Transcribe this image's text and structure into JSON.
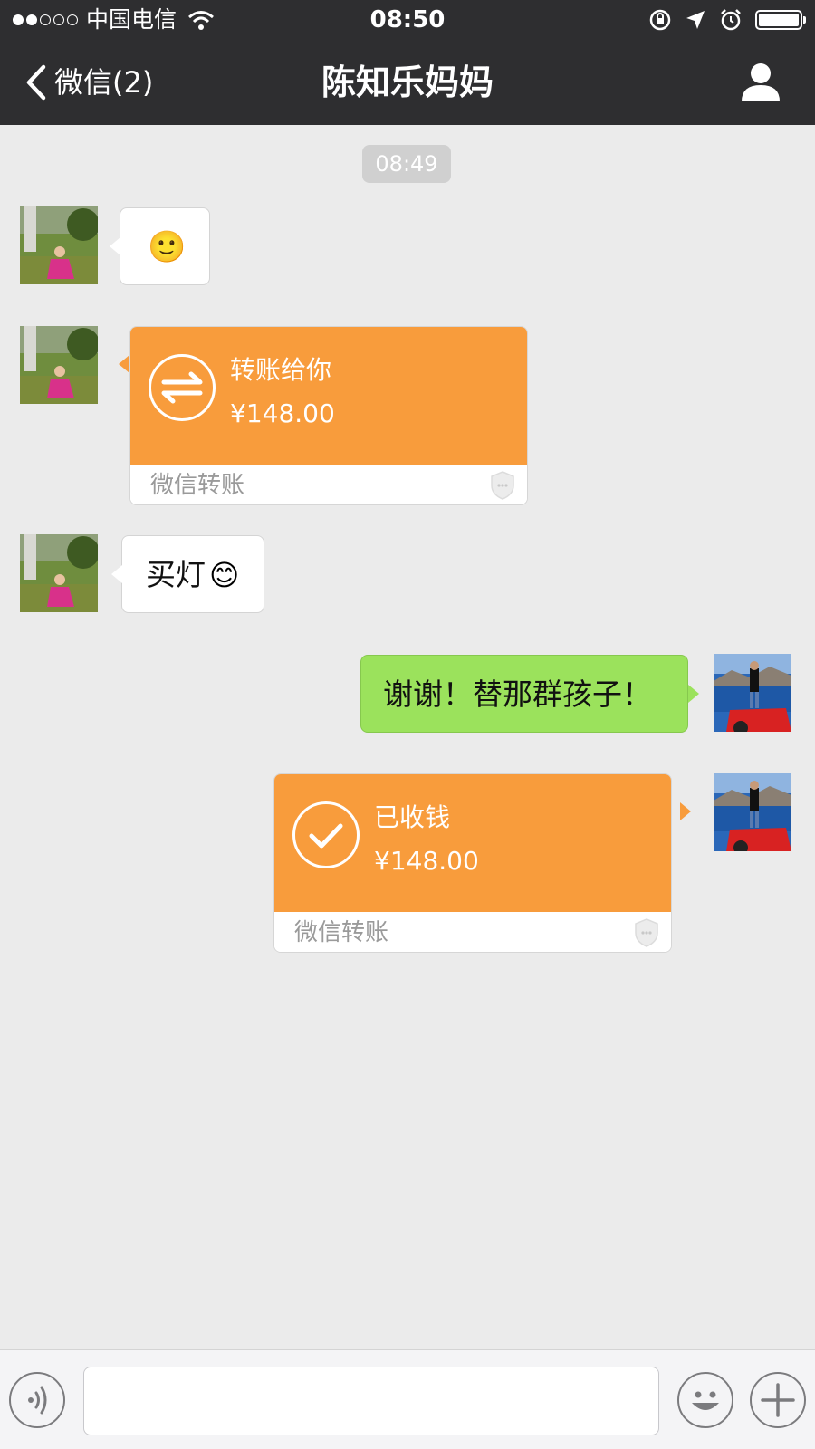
{
  "status_bar": {
    "carrier": "中国电信",
    "time": "08:50",
    "battery_level": 1.0,
    "signal_bars_filled": 2,
    "signal_bars_total": 5
  },
  "nav": {
    "back_label": "微信(2)",
    "title": "陈知乐妈妈",
    "profile_icon": "person-icon"
  },
  "chat": {
    "timestamp": "08:49",
    "messages": [
      {
        "side": "left",
        "type": "emoji",
        "emoji": "🙂"
      },
      {
        "side": "left",
        "type": "transfer",
        "title": "转账给你",
        "amount": "¥148.00",
        "footer": "微信转账",
        "icon": "transfer-arrows-icon"
      },
      {
        "side": "left",
        "type": "text",
        "text": "买灯",
        "emoji": "😊"
      },
      {
        "side": "right",
        "type": "text",
        "text": "谢谢！替那群孩子！"
      },
      {
        "side": "right",
        "type": "transfer",
        "title": "已收钱",
        "amount": "¥148.00",
        "footer": "微信转账",
        "icon": "check-icon"
      }
    ]
  },
  "colors": {
    "header_bg": "#2e2e30",
    "chat_bg": "#ebebeb",
    "transfer_orange": "#f89c3c",
    "bubble_green": "#9be25c"
  },
  "input_bar": {
    "text_value": "",
    "voice_icon": "voice-icon",
    "emoji_icon": "emoji-icon",
    "plus_icon": "plus-icon"
  }
}
